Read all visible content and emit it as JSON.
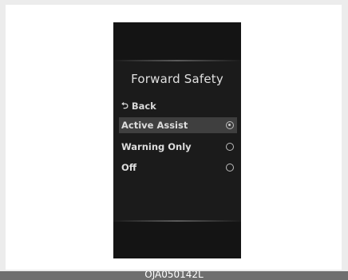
{
  "menu": {
    "title": "Forward Safety",
    "back_label": "Back",
    "back_icon": "return-arrow-icon",
    "options": [
      {
        "label": "Active Assist",
        "selected": true
      },
      {
        "label": "Warning Only",
        "selected": false
      },
      {
        "label": "Off",
        "selected": false
      }
    ]
  },
  "figure_code": "OJA050142L",
  "colors": {
    "screen_bg": "#1b1b1b",
    "highlight": "#3f3f3f",
    "text": "#dddddd"
  }
}
